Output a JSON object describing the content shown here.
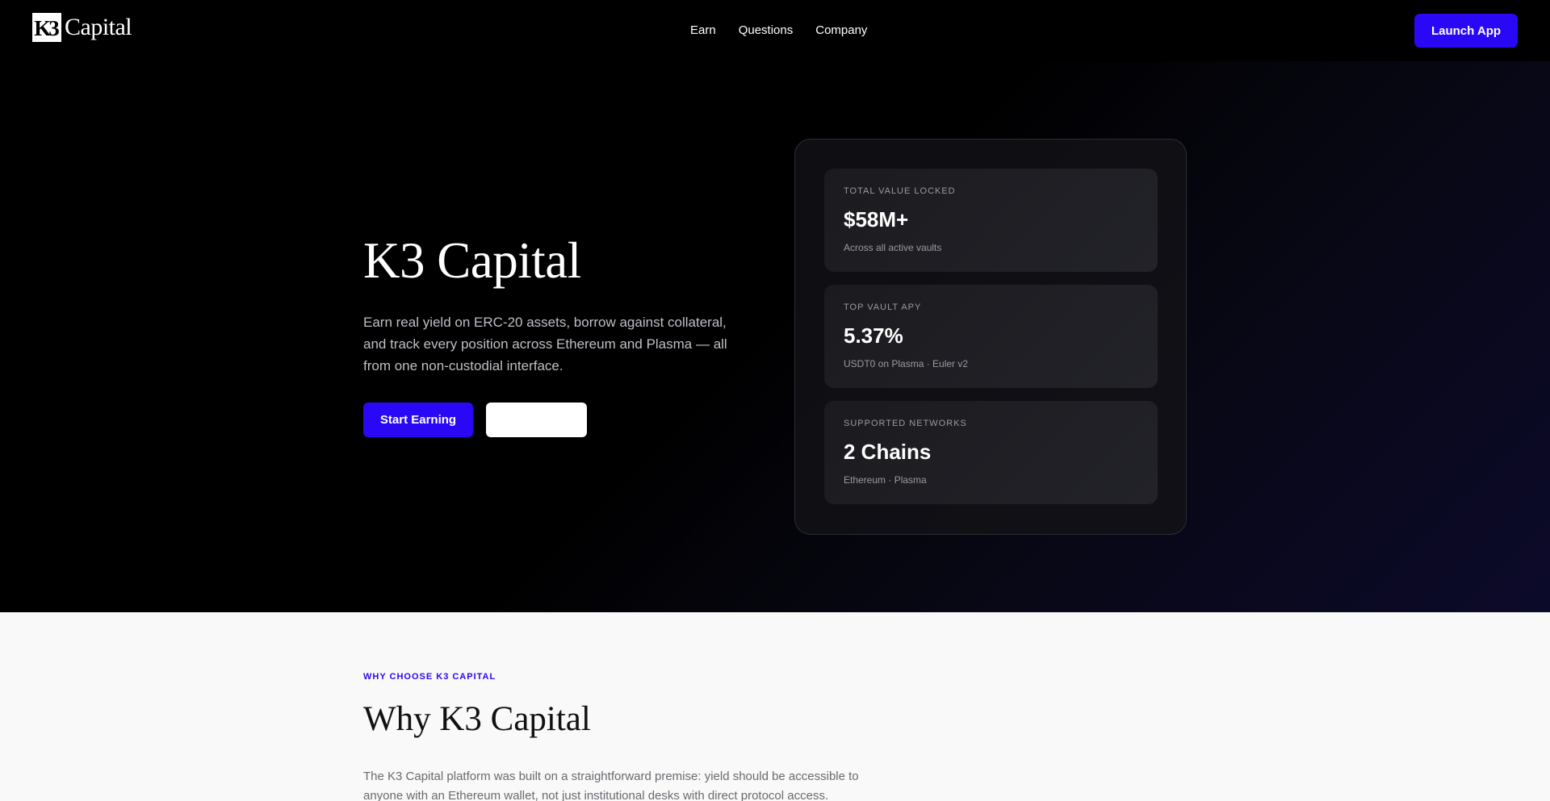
{
  "nav": {
    "logo_mark": "K3",
    "logo_text": "Capital",
    "links": [
      "Earn",
      "Questions",
      "Company"
    ],
    "launch_label": "Launch App"
  },
  "hero": {
    "title": "K3 Capital",
    "description": "Earn real yield on ERC-20 assets, borrow against collateral, and track every position across Ethereum and Plasma — all from one non-custodial interface.",
    "primary_cta": "Start Earning",
    "secondary_cta": ""
  },
  "stats": [
    {
      "label": "TOTAL VALUE LOCKED",
      "value": "$58M+",
      "sub": "Across all active vaults"
    },
    {
      "label": "TOP VAULT APY",
      "value": "5.37%",
      "sub": "USDT0 on Plasma · Euler v2"
    },
    {
      "label": "SUPPORTED NETWORKS",
      "value": "2 Chains",
      "sub": "Ethereum · Plasma"
    }
  ],
  "why": {
    "eyebrow": "WHY CHOOSE K3 CAPITAL",
    "title": "Why K3 Capital",
    "text": "The K3 Capital platform was built on a straightforward premise: yield should be accessible to anyone with an Ethereum wallet, not just institutional desks with direct protocol access."
  },
  "colors": {
    "accent": "#2a07f5",
    "background": "#000000",
    "section_light": "#f9f9f9"
  }
}
